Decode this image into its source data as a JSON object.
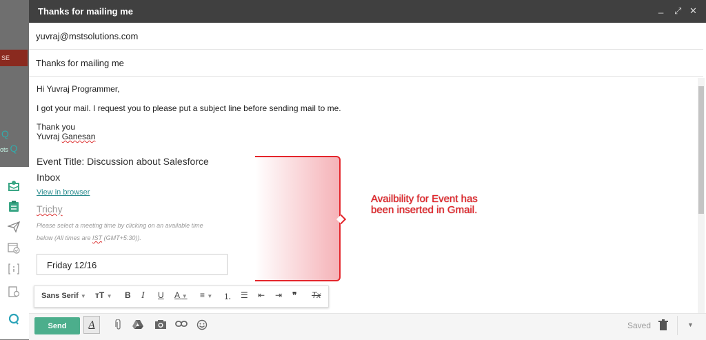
{
  "background": {
    "red_button_label": "SE",
    "q_icon_text": "Q",
    "q_icon_text2": "Q",
    "side_text": "ots"
  },
  "window": {
    "title": "Thanks for mailing me",
    "minimize": "_",
    "popout": "⤢",
    "close": "✕"
  },
  "compose": {
    "to": "yuvraj@mstsolutions.com",
    "subject": "Thanks for mailing me",
    "greeting": "Hi Yuvraj Programmer,",
    "body_line": "I got your mail. I request you to please put a subject line before sending mail to me.",
    "signoff_1": "Thank you",
    "signoff_2_first": "Yuvraj",
    "signoff_2_last": "Ganesan"
  },
  "event": {
    "title": "Event Title: Discussion about Salesforce",
    "folder": "Inbox",
    "view_link": "View in browser",
    "location": "Trichy",
    "instruction_1": "Please select a meeting time by clicking on an available time",
    "instruction_2a": "below (All times are",
    "instruction_2b": "IST",
    "instruction_2c": "(GMT+5:30)).",
    "date_option": "Friday 12/16"
  },
  "annotation": {
    "line1": "Availbility for Event has",
    "line2": "been inserted in Gmail."
  },
  "format_toolbar": {
    "font": "Sans Serif",
    "size": "тT",
    "bold": "B",
    "italic": "I",
    "underline": "U",
    "text_color": "A",
    "align": "≡",
    "numbered": "⒈",
    "bulleted": "☰",
    "indent_less": "⇤",
    "indent_more": "⇥",
    "quote": "❞",
    "clear": "Tx"
  },
  "bottom_bar": {
    "send_label": "Send",
    "format_label": "A",
    "saved_label": "Saved"
  },
  "colors": {
    "accent_green": "#4cae8c",
    "annotation_red": "#e4252b",
    "titlebar": "#404040"
  }
}
